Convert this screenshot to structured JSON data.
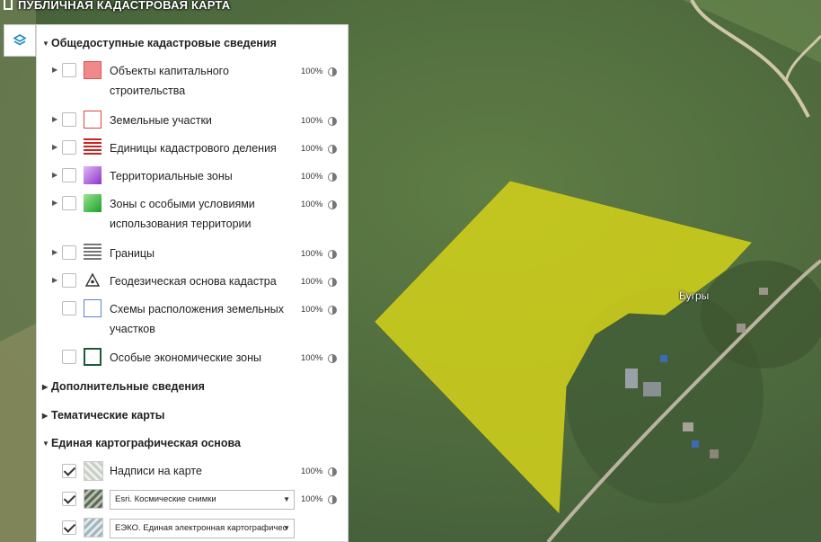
{
  "app": {
    "title": "ПУБЛИЧНАЯ КАДАСТРОВАЯ КАРТА"
  },
  "map": {
    "place_label": "Бугры",
    "parcel_color": "#d4d21a"
  },
  "panel": {
    "sections": [
      {
        "title": "Общедоступные кадастровые сведения",
        "expanded": true
      },
      {
        "title": "Дополнительные сведения",
        "expanded": false
      },
      {
        "title": "Тематические карты",
        "expanded": false
      },
      {
        "title": "Единая картографическая основа",
        "expanded": true
      }
    ],
    "cadastral_layers": [
      {
        "label": "Объекты капитального строительства",
        "opacity": "100%",
        "checked": false,
        "icon": "capital-construction-icon"
      },
      {
        "label": "Земельные участки",
        "opacity": "100%",
        "checked": false,
        "icon": "land-plots-icon"
      },
      {
        "label": "Единицы кадастрового деления",
        "opacity": "100%",
        "checked": false,
        "icon": "cadastral-division-icon"
      },
      {
        "label": "Территориальные зоны",
        "opacity": "100%",
        "checked": false,
        "icon": "territorial-zones-icon"
      },
      {
        "label": "Зоны с особыми условиями использования территории",
        "opacity": "100%",
        "checked": false,
        "icon": "special-zones-icon"
      },
      {
        "label": "Границы",
        "opacity": "100%",
        "checked": false,
        "icon": "borders-icon"
      },
      {
        "label": "Геодезическая основа кадастра",
        "opacity": "100%",
        "checked": false,
        "icon": "geodetic-icon"
      },
      {
        "label": "Схемы расположения земельных участков",
        "opacity": "100%",
        "checked": false,
        "icon": "layout-schemes-icon"
      },
      {
        "label": "Особые экономические зоны",
        "opacity": "100%",
        "checked": false,
        "icon": "economic-zones-icon"
      }
    ],
    "base_layers": [
      {
        "label": "Надписи на карте",
        "opacity": "100%",
        "checked": true,
        "icon": "map-labels-icon"
      },
      {
        "select_value": "Esri. Космические снимки",
        "opacity": "100%",
        "checked": true,
        "icon": "satellite-icon"
      },
      {
        "select_value": "ЕЭКО. Единая электронная картографичес",
        "checked": true,
        "icon": "eeko-icon"
      }
    ]
  }
}
